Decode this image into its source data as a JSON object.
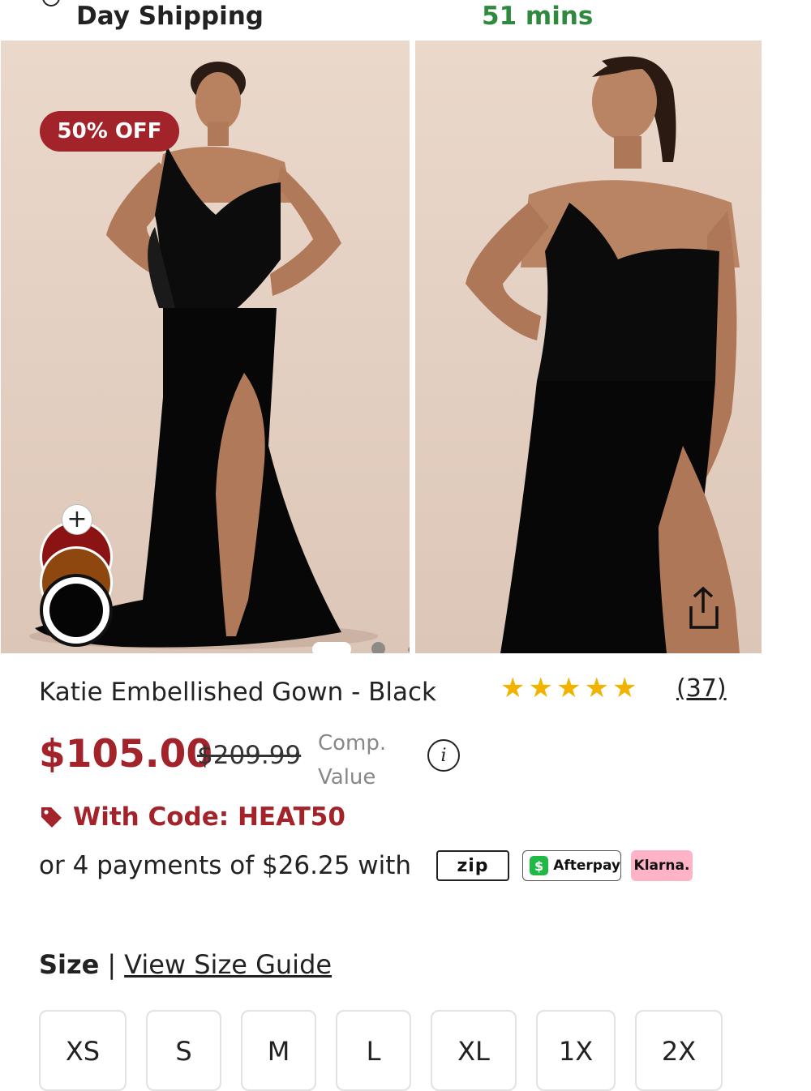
{
  "top_bar": {
    "shipping_text": "Day Shipping",
    "timer_text": "51 mins"
  },
  "gallery": {
    "badge": "50% OFF",
    "plus_symbol": "+",
    "swatch_colors": [
      "#8c1313",
      "#8f4710",
      "#050505"
    ],
    "selected_swatch": "black",
    "slide_count": 3,
    "active_slide": 1
  },
  "product": {
    "title": "Katie Embellished Gown - Black",
    "rating_stars": 5,
    "star_glyph": "★",
    "review_count": "(37)",
    "price": "$105.00",
    "compare_price": "$209.99",
    "compare_label": "Comp. Value",
    "info_glyph": "i",
    "promo_code": "With Code: HEAT50",
    "payments_text": "or 4 payments of $26.25 with",
    "payment_providers": {
      "zip": "zip",
      "afterpay": "Afterpay",
      "afterpay_mark": "$",
      "klarna": "Klarna."
    }
  },
  "size": {
    "label": "Size",
    "separator": "|",
    "guide_link": "View Size Guide",
    "options": [
      "XS",
      "S",
      "M",
      "L",
      "XL",
      "1X",
      "2X"
    ]
  },
  "colors": {
    "accent": "#a3232b",
    "timer_green": "#2f8a3f",
    "star_gold": "#f0b400",
    "afterpay_green": "#1fba45",
    "klarna_pink": "#ffb3c7"
  }
}
